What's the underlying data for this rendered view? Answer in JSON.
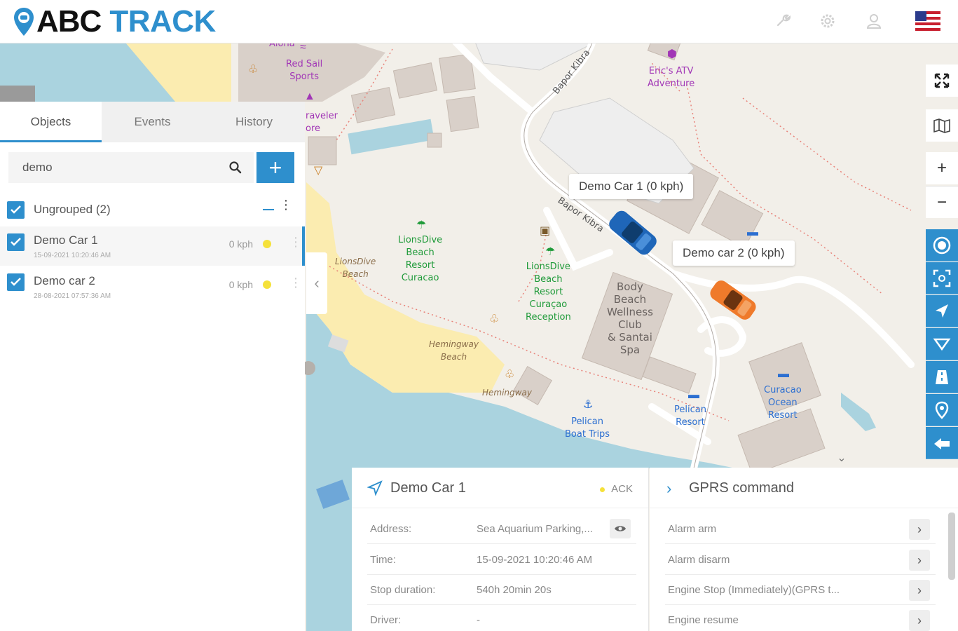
{
  "app": {
    "logo_abc": "ABC",
    "logo_track": "TRACK"
  },
  "topbar_icons": [
    "wrench-icon",
    "gear-icon",
    "user-icon",
    "us-flag-icon"
  ],
  "tabs": [
    {
      "label": "Objects",
      "active": true
    },
    {
      "label": "Events",
      "active": false
    },
    {
      "label": "History",
      "active": false
    }
  ],
  "search": {
    "value": "demo"
  },
  "groups": [
    {
      "label": "Ungrouped (2)",
      "objects": [
        {
          "name": "Demo Car 1",
          "timestamp": "15-09-2021 10:20:46 AM",
          "speed": "0 kph",
          "status_color": "#f5e13a",
          "selected": true
        },
        {
          "name": "Demo car 2",
          "timestamp": "28-08-2021 07:57:36 AM",
          "speed": "0 kph",
          "status_color": "#f5e13a",
          "selected": false
        }
      ]
    }
  ],
  "map": {
    "callouts": [
      {
        "text": "Demo Car 1 (0 kph)"
      },
      {
        "text": "Demo car 2 (0 kph)"
      }
    ],
    "labels": {
      "aloha": "Aloha",
      "red_sail": "Red Sail\nSports",
      "traveler": "raveler\nore",
      "erics_atv": "Eric's ATV\nAdventure",
      "lionsdive_resort": "LionsDive\nBeach\nResort\nCuracao",
      "lionsdive_reception": "LionsDive\nBeach\nResort\nCuraçao\nReception",
      "lionsdive_beach": "LionsDive\nBeach",
      "body_beach": "Body\nBeach\nWellness\nClub\n& Santai\nSpa",
      "hemingway_beach": "Hemingway\nBeach",
      "hemingway": "Hemingway",
      "pelican_boat": "Pelican\nBoat Trips",
      "pelican_resort": "Pelican\nResort",
      "curacao_ocean": "Curacao\nOcean\nResort",
      "bapor_kibra_1": "Bapor Kibra",
      "bapor_kibra_2": "Bapor Kibra"
    },
    "accent": "#2e8fcd"
  },
  "info_panel": {
    "title": "Demo Car 1",
    "ack": "ACK",
    "rows": [
      {
        "key": "Address:",
        "value": "Sea Aquarium Parking,..."
      },
      {
        "key": "Time:",
        "value": "15-09-2021 10:20:46 AM"
      },
      {
        "key": "Stop duration:",
        "value": "540h 20min 20s"
      },
      {
        "key": "Driver:",
        "value": "-"
      }
    ]
  },
  "gprs_panel": {
    "title": "GPRS command",
    "commands": [
      {
        "label": "Alarm arm"
      },
      {
        "label": "Alarm disarm"
      },
      {
        "label": "Engine Stop (Immediately)(GPRS t..."
      },
      {
        "label": "Engine resume"
      }
    ]
  },
  "right_toolbar": {
    "white": [
      "fullscreen-icon",
      "map-layers-icon",
      "zoom-in-icon",
      "zoom-out-icon"
    ],
    "blue": [
      "target-icon",
      "fit-bounds-icon",
      "navigate-icon",
      "filter-icon",
      "road-icon",
      "pin-icon",
      "pointer-icon"
    ]
  }
}
